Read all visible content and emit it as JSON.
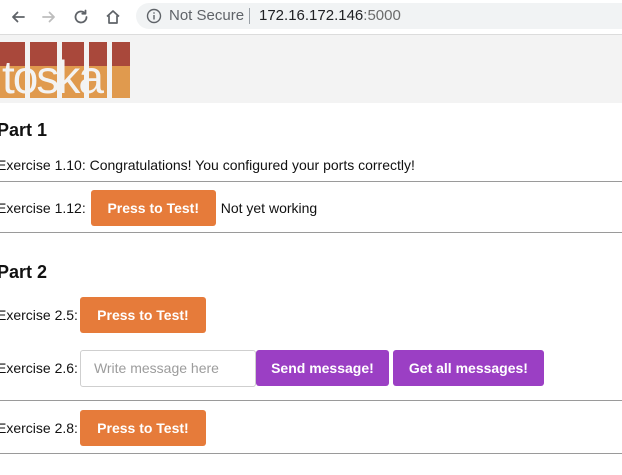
{
  "browser": {
    "security_label": "Not Secure",
    "url_host": "172.16.172.146",
    "url_port": ":5000"
  },
  "header": {
    "logo_text": "toska"
  },
  "part1": {
    "title": "Part 1",
    "ex110_text": "Exercise 1.10: Congratulations! You configured your ports correctly!",
    "ex112_label": "Exercise 1.12:",
    "ex112_button": "Press to Test!",
    "ex112_status": "Not yet working"
  },
  "part2": {
    "title": "Part 2",
    "ex25_label": "Exercise 2.5:",
    "ex25_button": "Press to Test!",
    "ex26_label": "Exercise 2.6:",
    "ex26_placeholder": "Write message here",
    "ex26_send_button": "Send message!",
    "ex26_get_button": "Get all messages!",
    "ex28_label": "Exercise 2.8:",
    "ex28_button": "Press to Test!"
  },
  "colors": {
    "orange_button": "#e67b3a",
    "purple_button": "#9b3fc4"
  }
}
